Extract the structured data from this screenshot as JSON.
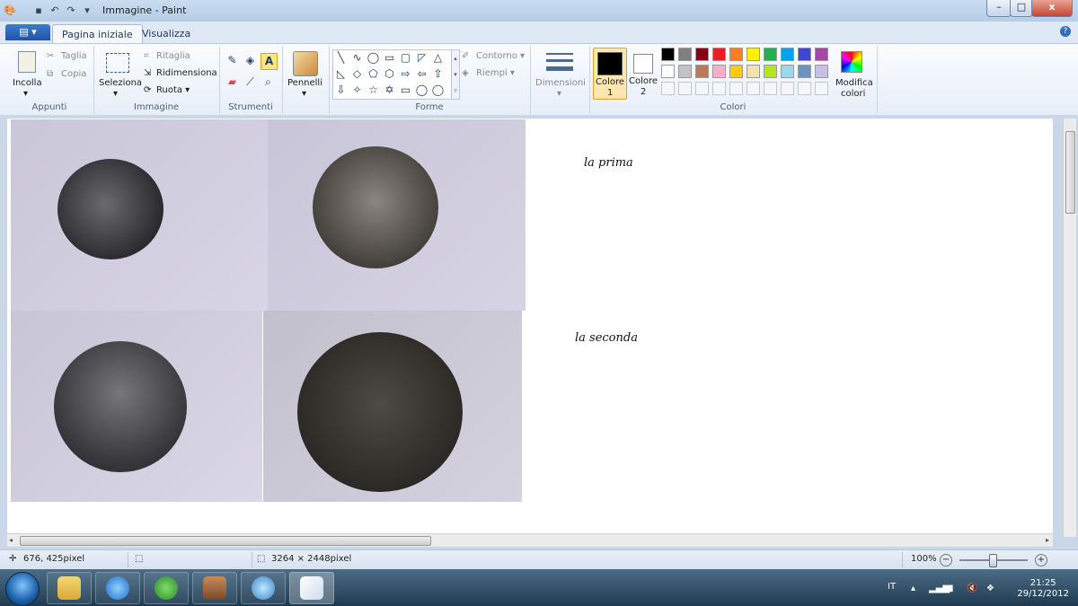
{
  "window": {
    "title": "Immagine - Paint",
    "controls": {
      "minimize": "–",
      "maximize": "□",
      "close": "x"
    }
  },
  "tabs": {
    "file_menu": "▤ ▾",
    "home": "Pagina iniziale",
    "view": "Visualizza",
    "help": "?"
  },
  "ribbon": {
    "appunti": {
      "label": "Appunti",
      "paste": "Incolla",
      "cut": "Taglia",
      "copy": "Copia"
    },
    "immagine": {
      "label": "Immagine",
      "select": "Seleziona",
      "crop": "Ritaglia",
      "resize": "Ridimensiona",
      "rotate": "Ruota ▾"
    },
    "strumenti": {
      "label": "Strumenti"
    },
    "pennelli": {
      "label": "Pennelli"
    },
    "forme": {
      "label": "Forme",
      "outline": "Contorno ▾",
      "fill": "Riempi ▾",
      "shapes": [
        "╲",
        "∿",
        "◯",
        "▭",
        "▢",
        "◸",
        "△",
        "◺",
        "◇",
        "⬠",
        "⬡",
        "⇨",
        "⇦",
        "⇧",
        "⇩",
        "✧",
        "☆",
        "✡",
        "▭",
        "◯",
        "◯"
      ]
    },
    "dimensioni": {
      "label": "Dimensioni"
    },
    "colori": {
      "label": "Colori",
      "color1_label": "Colore",
      "color1_num": "1",
      "color2_label": "Colore",
      "color2_num": "2",
      "edit_label": "Modifica",
      "edit_label2": "colori",
      "color1_value": "#000000",
      "color2_value": "#ffffff",
      "row1": [
        "#000000",
        "#7f7f7f",
        "#880015",
        "#ed1c24",
        "#ff7f27",
        "#fff200",
        "#22b14c",
        "#00a2e8",
        "#3f48cc",
        "#a349a4"
      ],
      "row2": [
        "#ffffff",
        "#c3c3c3",
        "#b97a57",
        "#ffaec9",
        "#ffc90e",
        "#efe4b0",
        "#b5e61d",
        "#99d9ea",
        "#7092be",
        "#c8bfe7"
      ]
    }
  },
  "canvas": {
    "annotation_first": "la prima",
    "annotation_second": "la seconda"
  },
  "statusbar": {
    "cursor_position": "676, 425pixel",
    "image_size": "3264 × 2448pixel",
    "zoom": "100%"
  },
  "taskbar": {
    "language": "IT",
    "time": "21:25",
    "date": "29/12/2012"
  }
}
